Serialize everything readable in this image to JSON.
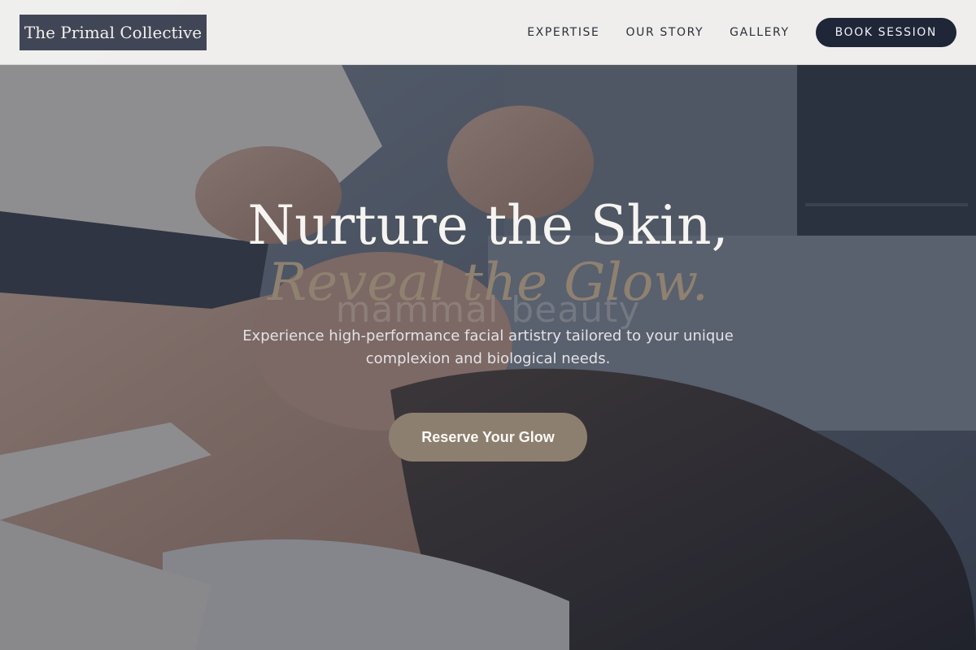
{
  "brand": {
    "logo_text": "The Primal Collective"
  },
  "nav": {
    "items": [
      {
        "label": "EXPERTISE"
      },
      {
        "label": "OUR STORY"
      },
      {
        "label": "GALLERY"
      }
    ],
    "cta_label": "BOOK SESSION"
  },
  "hero": {
    "headline_line1": "Nurture the Skin,",
    "headline_line2": "Reveal the Glow.",
    "watermark": "mammal beauty",
    "subtext": "Experience high-performance facial artistry tailored to your unique complexion and biological needs.",
    "cta_label": "Reserve Your Glow"
  },
  "colors": {
    "logo_bg": "#414657",
    "book_button_bg": "#1f2637",
    "accent_taupe": "#8d7f6f",
    "hero_overlay": "#282e3c"
  }
}
